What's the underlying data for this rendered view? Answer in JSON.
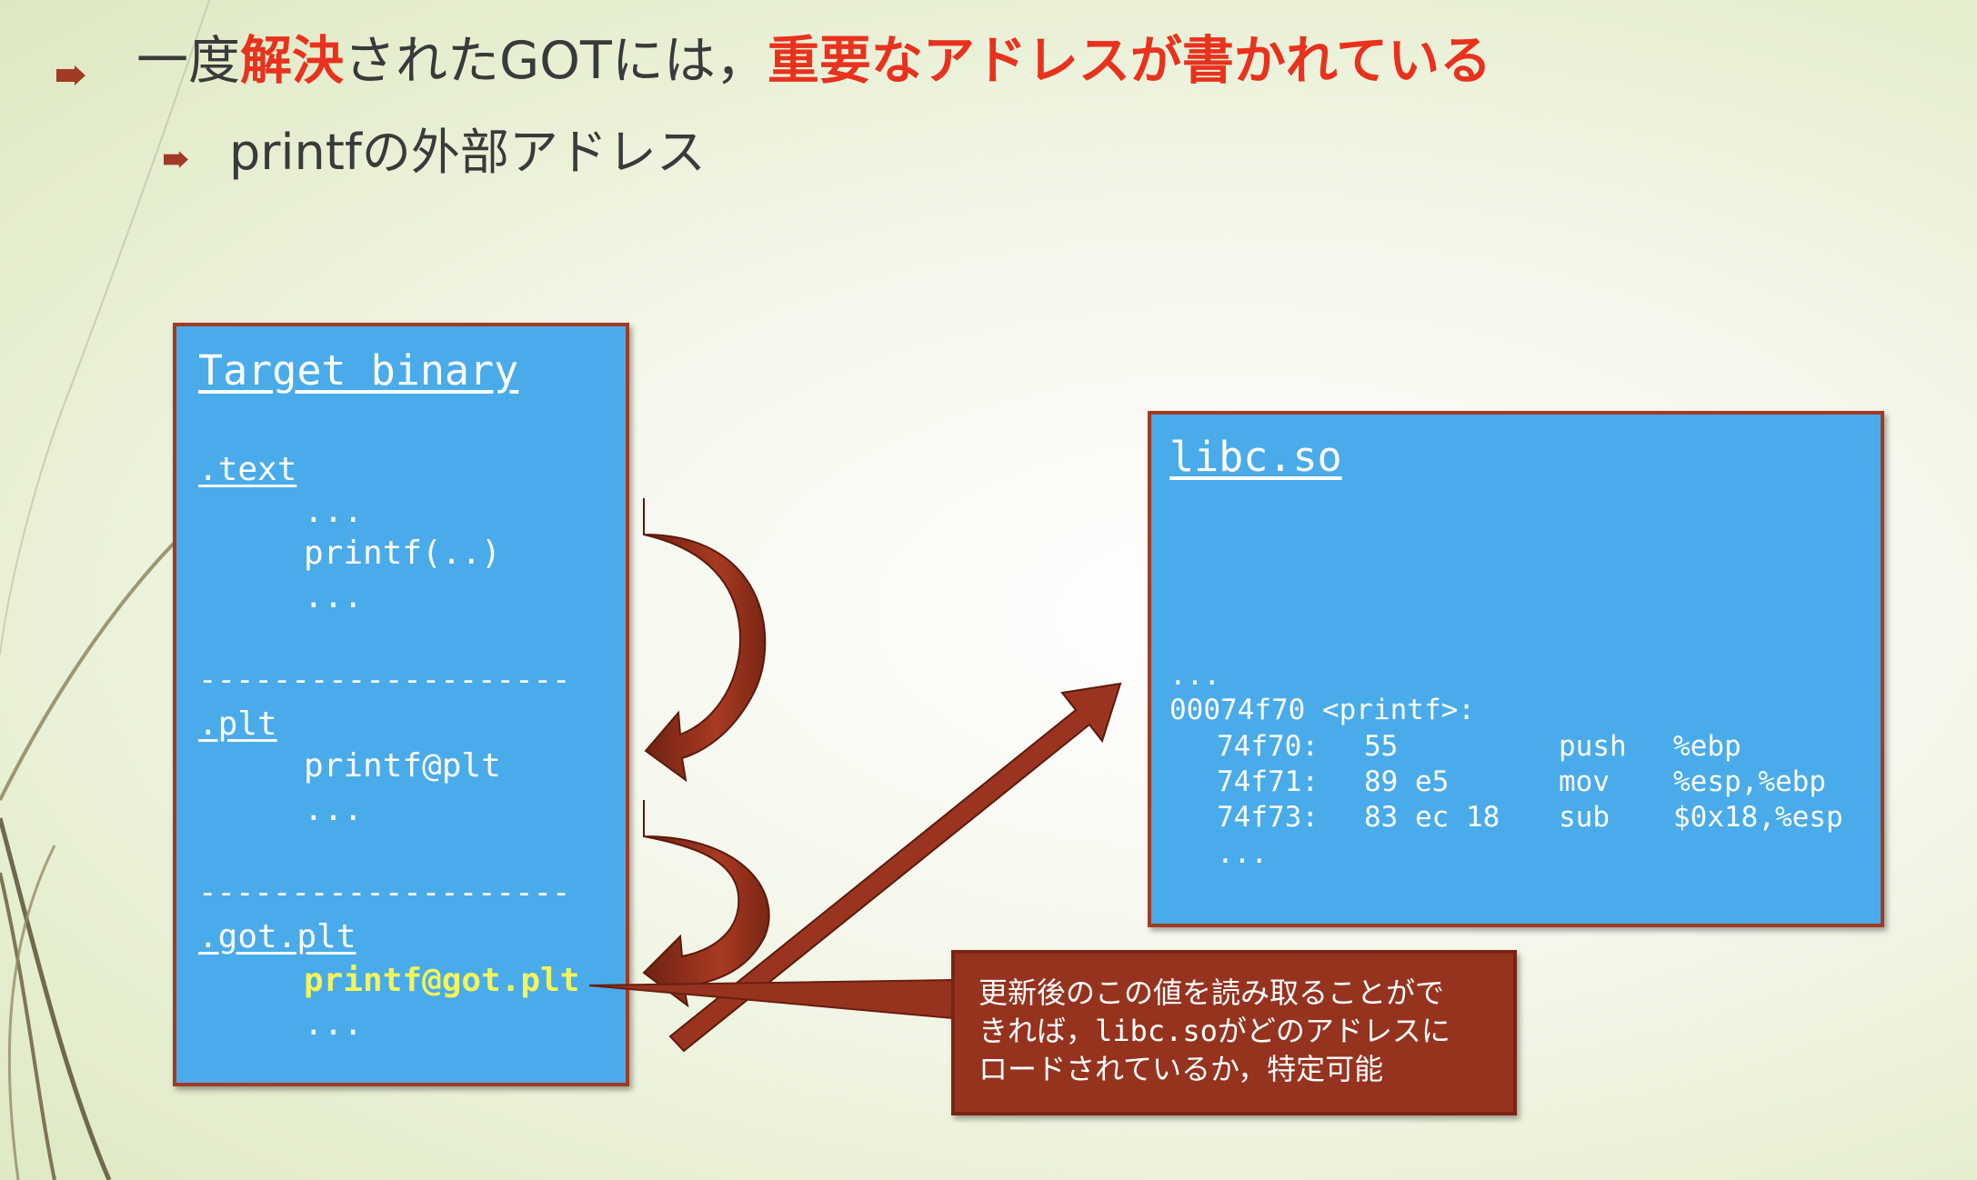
{
  "title": {
    "part1": "一度",
    "part2": "解決",
    "part3": "されたGOTには，",
    "part4": "重要なアドレスが書かれている"
  },
  "subtitle": "printfの外部アドレス",
  "target": {
    "header": "Target binary",
    "text_section": ".text",
    "text_lines": [
      "...",
      "printf(..)",
      "..."
    ],
    "divider": "--------------------",
    "plt_section": ".plt",
    "plt_lines": [
      "printf@plt",
      "..."
    ],
    "got_section": ".got.plt",
    "got_highlight": "printf@got.plt",
    "got_after": "..."
  },
  "libc": {
    "header": "libc.so",
    "dots": "...",
    "symbol": "00074f70 <printf>:",
    "rows": [
      {
        "addr": "74f70:",
        "bytes": "55",
        "op": "push",
        "args": "%ebp"
      },
      {
        "addr": "74f71:",
        "bytes": "89 e5",
        "op": "mov",
        "args": "%esp,%ebp"
      },
      {
        "addr": "74f73:",
        "bytes": "83 ec 18",
        "op": "sub",
        "args": "$0x18,%esp"
      }
    ],
    "end": "..."
  },
  "callout": {
    "line1": "更新後のこの値を読み取ることがで",
    "line2a": "きれば，",
    "line2b": "libc.so",
    "line2c": "がどのアドレスに",
    "line3": "ロードされているか，特定可能"
  },
  "colors": {
    "box_fill": "#4aabea",
    "box_border": "#a23a25",
    "arrow": "#8b2e1c",
    "accent_red": "#e8321e",
    "highlight_yellow": "#f3f55a"
  }
}
